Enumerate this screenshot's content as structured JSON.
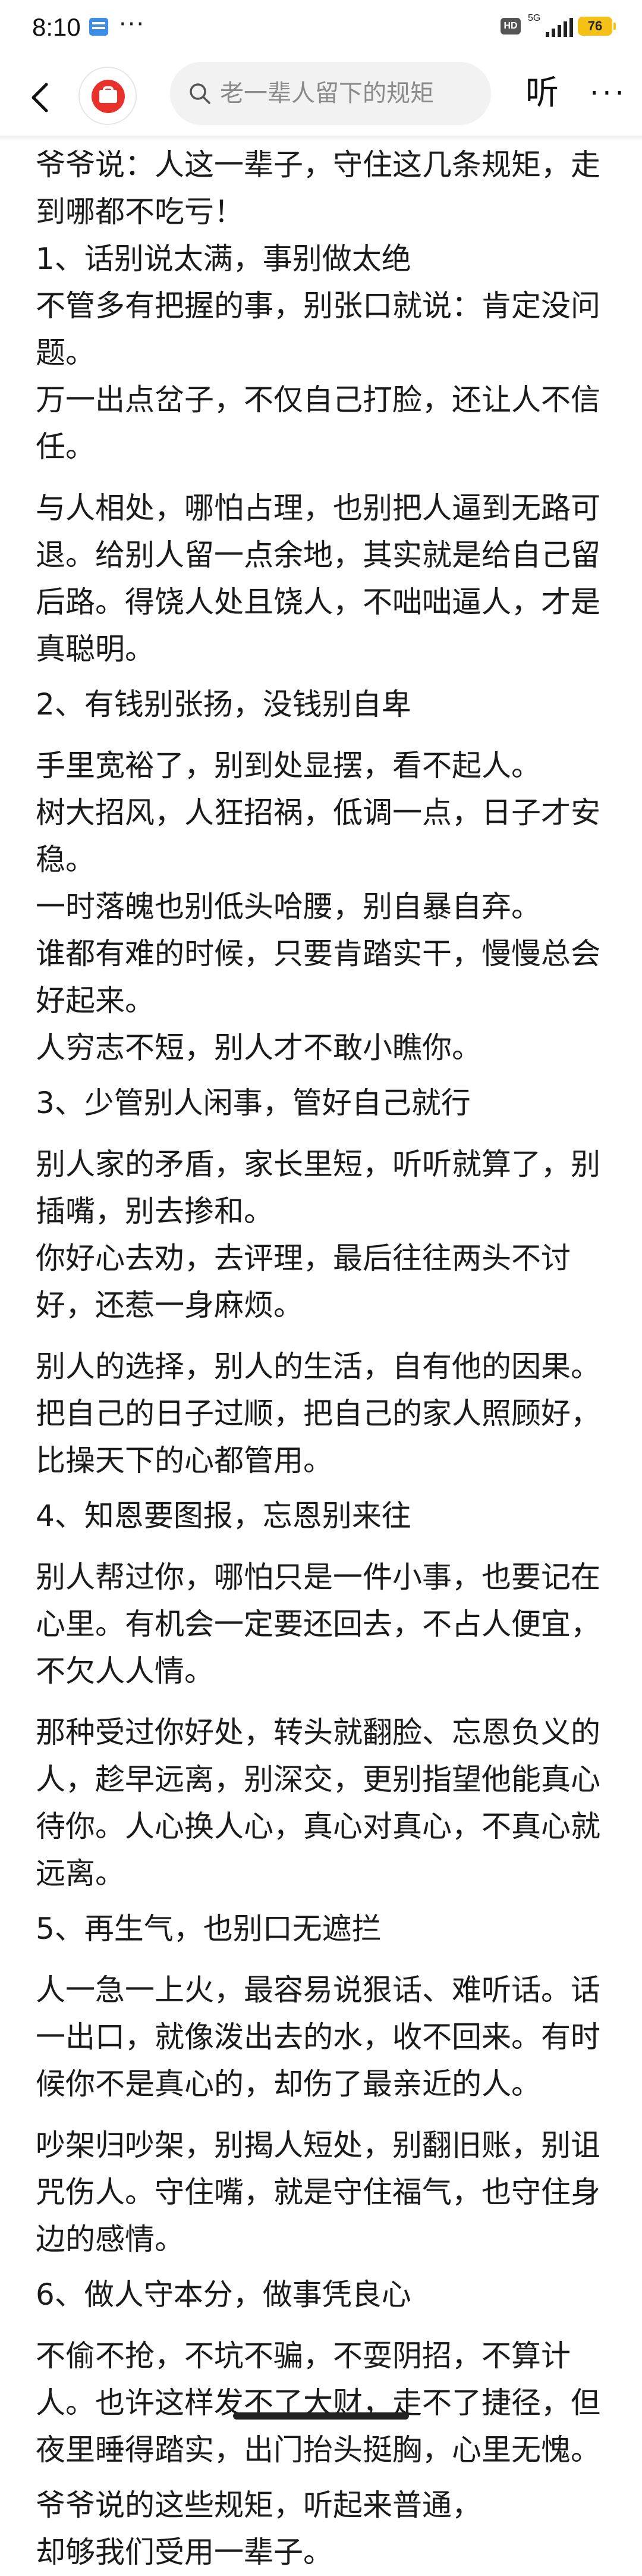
{
  "status_bar": {
    "time": "8:10",
    "dots": "···",
    "hd": "HD",
    "network": "5G",
    "battery": "76"
  },
  "nav": {
    "search_placeholder": "老一辈人留下的规矩",
    "listen_label": "听",
    "more_label": "···",
    "colors": {
      "logo": "#e8312a",
      "search_bg": "#f2f2f2"
    }
  },
  "article": {
    "paragraphs": [
      "爷爷说：人这一辈子，守住这几条规矩，走到哪都不吃亏！",
      "1、话别说太满，事别做太绝",
      " 不管多有把握的事，别张口就说：肯定没问题。",
      "万一出点岔子，不仅自己打脸，还让人不信任。",
      "与人相处，哪怕占理，也别把人逼到无路可退。给别人留一点余地，其实就是给自己留后路。得饶人处且饶人，不咄咄逼人，才是真聪明。",
      "2、有钱别张扬，没钱别自卑",
      "手里宽裕了，别到处显摆，看不起人。",
      "树大招风，人狂招祸，低调一点，日子才安稳。",
      " 一时落魄也别低头哈腰，别自暴自弃。",
      "谁都有难的时候，只要肯踏实干，慢慢总会好起来。",
      "人穷志不短，别人才不敢小瞧你。",
      "3、少管别人闲事，管好自己就行",
      "别人家的矛盾，家长里短，听听就算了，别插嘴，别去掺和。",
      "你好心去劝，去评理，最后往往两头不讨好，还惹一身麻烦。",
      "别人的选择，别人的生活，自有他的因果。把自己的日子过顺，把自己的家人照顾好，比操天下的心都管用。",
      "4、知恩要图报，忘恩别来往",
      "别人帮过你，哪怕只是一件小事，也要记在心里。有机会一定要还回去，不占人便宜，不欠人人情。",
      "那种受过你好处，转头就翻脸、忘恩负义的人，趁早远离，别深交，更别指望他能真心待你。人心换人心，真心对真心，不真心就远离。",
      "5、再生气，也别口无遮拦",
      "人一急一上火，最容易说狠话、难听话。话一出口，就像泼出去的水，收不回来。有时候你不是真心的，却伤了最亲近的人。",
      "吵架归吵架，别揭人短处，别翻旧账，别诅咒伤人。守住嘴，就是守住福气，也守住身边的感情。",
      "6、做人守本分，做事凭良心",
      "不偷不抢，不坑不骗，不耍阴招，不算计人。也许这样发不了大财，走不了捷径，但夜里睡得踏实，出门抬头挺胸，心里无愧。",
      "爷爷说的这些规矩，听起来普通，",
      "却够我们受用一辈子。"
    ]
  }
}
